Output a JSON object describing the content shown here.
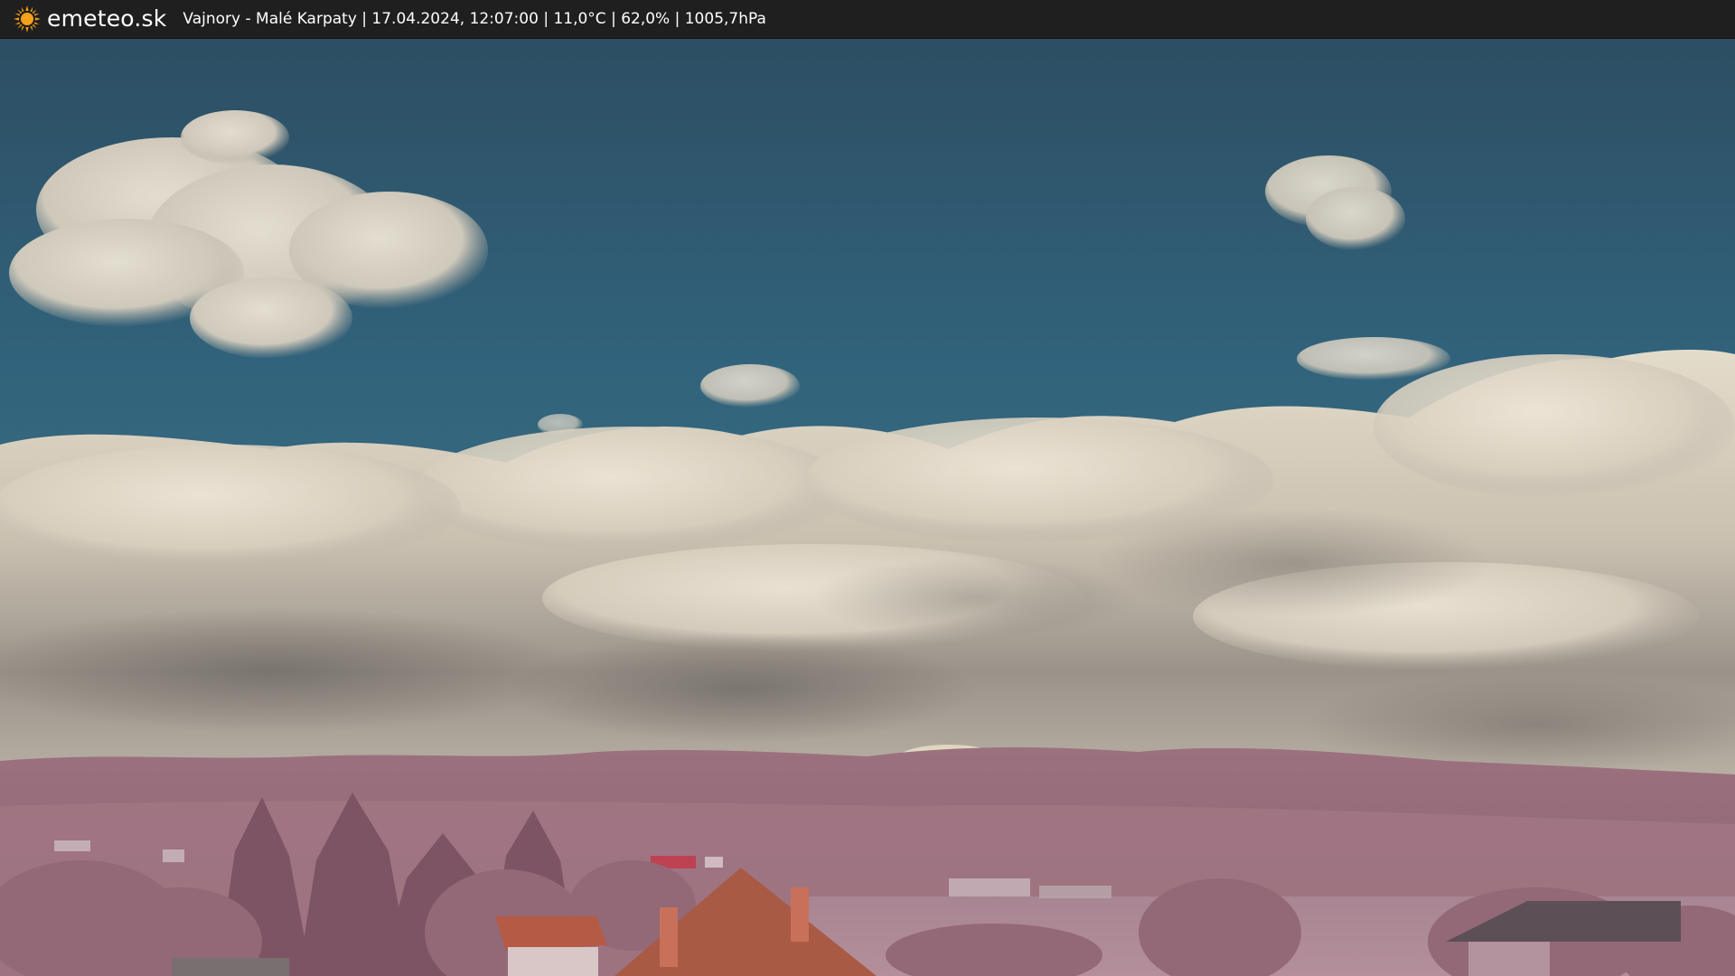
{
  "header": {
    "brand": "emeteo.sk",
    "station_info": "Vajnory - Malé Karpaty | 17.04.2024, 12:07:00 | 11,0°C | 62,0% | 1005,7hPa",
    "logo_icon": "sun-icon",
    "logo_color": "#f4a11a"
  },
  "colors": {
    "sky_top": "#2e5266",
    "sky_mid": "#31607a",
    "cloud_light": "#e6ddcc",
    "cloud_shadow": "#8f887f",
    "hills": "#9a6f7d",
    "foliage": "#b07f8c",
    "roof": "#b45f48"
  }
}
